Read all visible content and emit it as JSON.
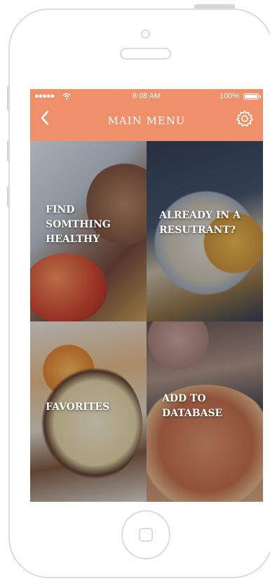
{
  "status_bar": {
    "carrier": "●●●●● ",
    "time": "8:08 AM",
    "battery": "100%"
  },
  "header": {
    "title": "MAIN MENU",
    "back_icon": "chevron-left-icon",
    "settings_icon": "gear-icon"
  },
  "tiles": [
    {
      "lines": [
        "FIND",
        "SOMTHING",
        "HEALTHY"
      ]
    },
    {
      "lines": [
        "ALREADY IN A",
        "RESUTRANT?"
      ]
    },
    {
      "lines": [
        "FAVORITES"
      ]
    },
    {
      "lines": [
        "ADD TO",
        "DATABASE"
      ]
    }
  ],
  "colors": {
    "accent": "#f0906a",
    "frame": "#dcdcdc"
  }
}
